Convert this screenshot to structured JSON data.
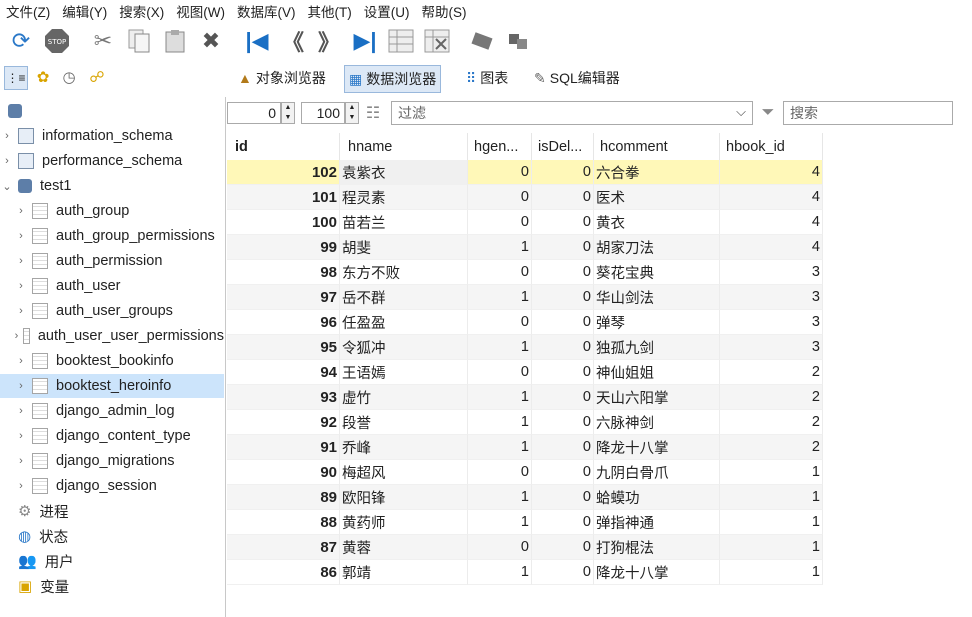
{
  "menu": [
    "文件(Z)",
    "编辑(Y)",
    "搜索(X)",
    "视图(W)",
    "数据库(V)",
    "其他(T)",
    "设置(U)",
    "帮助(S)"
  ],
  "toolbar_icons": [
    "refresh-icon",
    "stop-icon",
    "cut-icon",
    "copy-icon",
    "paste-icon",
    "delete-icon",
    "first-page-icon",
    "prev-page-icon",
    "next-page-icon",
    "last-page-icon",
    "insert-row-icon",
    "delete-row-icon",
    "apply-icon",
    "cancel-icon"
  ],
  "tabs": [
    {
      "label": "对象浏览器",
      "icon": "object-browser-icon"
    },
    {
      "label": "数据浏览器",
      "icon": "data-browser-icon"
    },
    {
      "label": "图表",
      "icon": "chart-icon"
    },
    {
      "label": "SQL编辑器",
      "icon": "sql-editor-icon"
    }
  ],
  "tree": [
    {
      "label": "information_schema",
      "type": "schema",
      "expanded": false
    },
    {
      "label": "performance_schema",
      "type": "schema",
      "expanded": false
    },
    {
      "label": "test1",
      "type": "db",
      "expanded": true
    },
    {
      "label": "auth_group",
      "type": "table"
    },
    {
      "label": "auth_group_permissions",
      "type": "table"
    },
    {
      "label": "auth_permission",
      "type": "table"
    },
    {
      "label": "auth_user",
      "type": "table"
    },
    {
      "label": "auth_user_groups",
      "type": "table"
    },
    {
      "label": "auth_user_user_permissions",
      "type": "table"
    },
    {
      "label": "booktest_bookinfo",
      "type": "table"
    },
    {
      "label": "booktest_heroinfo",
      "type": "table",
      "selected": true
    },
    {
      "label": "django_admin_log",
      "type": "table"
    },
    {
      "label": "django_content_type",
      "type": "table"
    },
    {
      "label": "django_migrations",
      "type": "table"
    },
    {
      "label": "django_session",
      "type": "table"
    }
  ],
  "tree_extra": [
    {
      "label": "进程",
      "icon": "process-icon"
    },
    {
      "label": "状态",
      "icon": "status-icon"
    },
    {
      "label": "用户",
      "icon": "users-icon"
    },
    {
      "label": "变量",
      "icon": "variables-icon"
    }
  ],
  "filter": {
    "offset": "0",
    "limit": "100",
    "filter_placeholder": "过滤",
    "search_placeholder": "搜索"
  },
  "columns": [
    "id",
    "hname",
    "hgen...",
    "isDel...",
    "hcomment",
    "hbook_id"
  ],
  "rows": [
    [
      "102",
      "袁紫衣",
      "0",
      "0",
      "六合拳",
      "4"
    ],
    [
      "101",
      "程灵素",
      "0",
      "0",
      "医术",
      "4"
    ],
    [
      "100",
      "苗若兰",
      "0",
      "0",
      "黄衣",
      "4"
    ],
    [
      "99",
      "胡斐",
      "1",
      "0",
      "胡家刀法",
      "4"
    ],
    [
      "98",
      "东方不败",
      "0",
      "0",
      "葵花宝典",
      "3"
    ],
    [
      "97",
      "岳不群",
      "1",
      "0",
      "华山剑法",
      "3"
    ],
    [
      "96",
      "任盈盈",
      "0",
      "0",
      "弹琴",
      "3"
    ],
    [
      "95",
      "令狐冲",
      "1",
      "0",
      "独孤九剑",
      "3"
    ],
    [
      "94",
      "王语嫣",
      "0",
      "0",
      "神仙姐姐",
      "2"
    ],
    [
      "93",
      "虚竹",
      "1",
      "0",
      "天山六阳掌",
      "2"
    ],
    [
      "92",
      "段誉",
      "1",
      "0",
      "六脉神剑",
      "2"
    ],
    [
      "91",
      "乔峰",
      "1",
      "0",
      "降龙十八掌",
      "2"
    ],
    [
      "90",
      "梅超风",
      "0",
      "0",
      "九阴白骨爪",
      "1"
    ],
    [
      "89",
      "欧阳锋",
      "1",
      "0",
      "蛤蟆功",
      "1"
    ],
    [
      "88",
      "黄药师",
      "1",
      "0",
      "弹指神通",
      "1"
    ],
    [
      "87",
      "黄蓉",
      "0",
      "0",
      "打狗棍法",
      "1"
    ],
    [
      "86",
      "郭靖",
      "1",
      "0",
      "降龙十八掌",
      "1"
    ]
  ],
  "selected_row": 0
}
